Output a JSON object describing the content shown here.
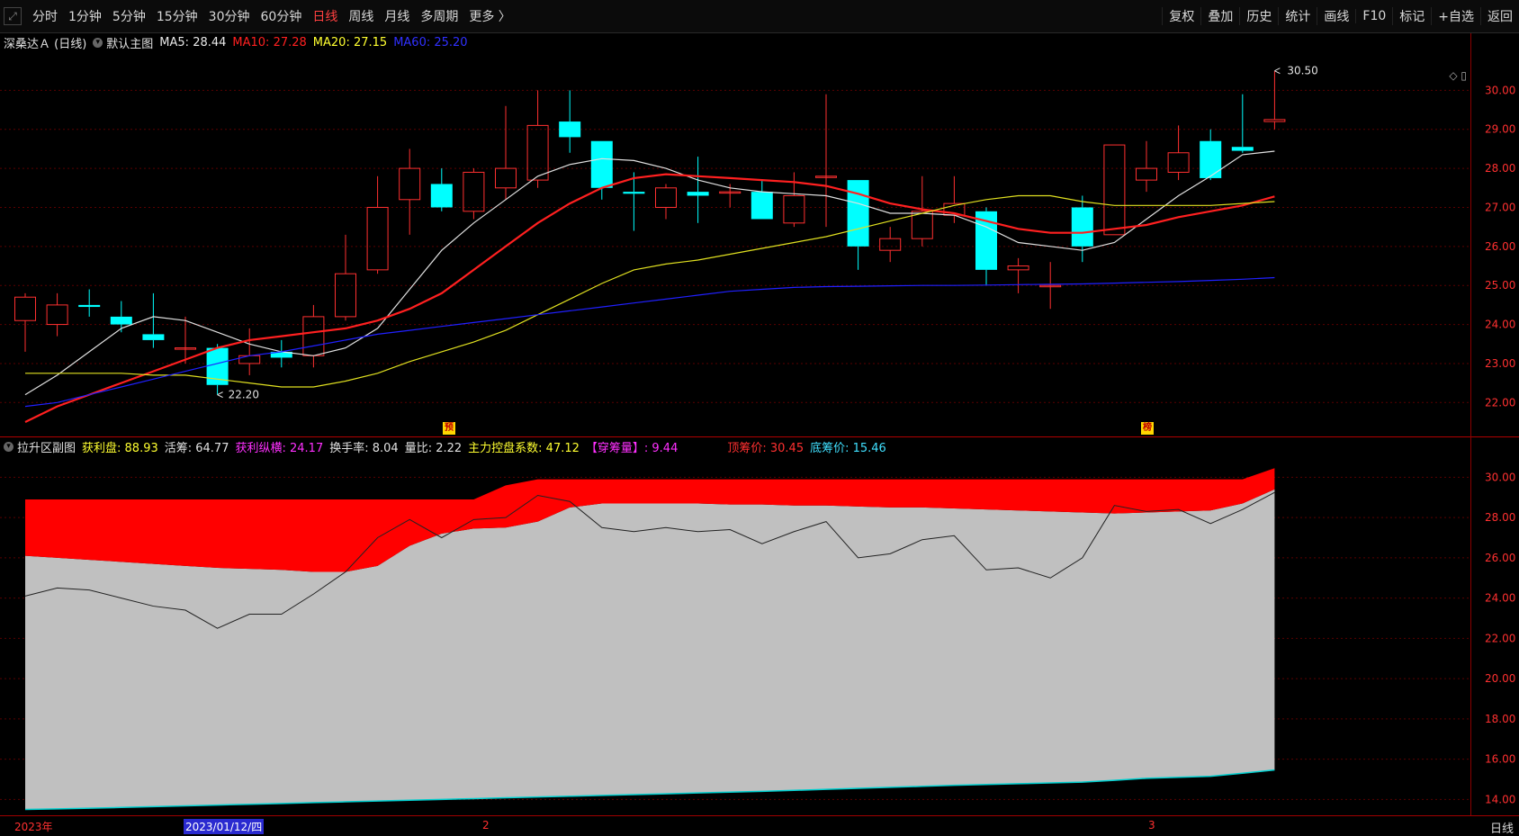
{
  "toolbar": {
    "periods": [
      "分时",
      "1分钟",
      "5分钟",
      "15分钟",
      "30分钟",
      "60分钟",
      "日线",
      "周线",
      "月线",
      "多周期",
      "更多 〉"
    ],
    "active_period": "日线",
    "right_buttons": [
      "复权",
      "叠加",
      "历史",
      "统计",
      "画线",
      "F10",
      "标记",
      "+自选",
      "返回"
    ]
  },
  "main_info": {
    "stock": "深桑达Ａ (日线)",
    "template": "默认主图",
    "ma5": "MA5: 28.44",
    "ma10": "MA10: 27.28",
    "ma20": "MA20: 27.15",
    "ma60": "MA60: 25.20"
  },
  "sub_info": {
    "name": "拉升区副图",
    "profit": "获利盘: 88.93",
    "active": "活筹: 64.77",
    "profit_span": "获利纵横: 24.17",
    "turnover": "换手率: 8.04",
    "volume_ratio": "量比: 2.22",
    "control": "主力控盘系数: 47.12",
    "chip_wear": "【穿筹量】: 9.44",
    "top_price": "顶筹价: 30.45",
    "bottom_price": "底筹价: 15.46"
  },
  "colors": {
    "up": "#ff3030",
    "down": "#00ffff",
    "ma5": "#e0e0e0",
    "ma10": "#ff2020",
    "ma20": "#e0e020",
    "ma60": "#2020ff",
    "grid": "#5a0000",
    "chip_red": "#ff0000",
    "chip_gray": "#c0c0c0",
    "bottom_line": "#00d0d0"
  },
  "markers": {
    "pre": "预",
    "list": "榜"
  },
  "dates": {
    "year": "2023年",
    "cursor": "2023/01/12/四",
    "m2": "2",
    "m3": "3",
    "period": "日线"
  },
  "chart_data": [
    {
      "type": "candlestick",
      "title": "深桑达Ａ (日线)",
      "ylim": [
        21.2,
        31.0
      ],
      "yticks": [
        22,
        23,
        24,
        25,
        26,
        27,
        28,
        29,
        30
      ],
      "annotations": {
        "high": "30.50",
        "low": "22.20"
      },
      "candles": [
        {
          "o": 24.1,
          "h": 24.8,
          "l": 23.3,
          "c": 24.7
        },
        {
          "o": 24.0,
          "h": 24.8,
          "l": 23.7,
          "c": 24.5
        },
        {
          "o": 24.5,
          "h": 24.9,
          "l": 24.2,
          "c": 24.45
        },
        {
          "o": 24.2,
          "h": 24.6,
          "l": 23.8,
          "c": 24.0
        },
        {
          "o": 23.75,
          "h": 24.8,
          "l": 23.4,
          "c": 23.6
        },
        {
          "o": 23.4,
          "h": 24.2,
          "l": 23.0,
          "c": 23.4
        },
        {
          "o": 23.4,
          "h": 23.5,
          "l": 22.2,
          "c": 22.45
        },
        {
          "o": 23.0,
          "h": 23.9,
          "l": 22.7,
          "c": 23.2
        },
        {
          "o": 23.3,
          "h": 23.6,
          "l": 22.9,
          "c": 23.15
        },
        {
          "o": 23.2,
          "h": 24.5,
          "l": 22.9,
          "c": 24.2
        },
        {
          "o": 24.2,
          "h": 26.3,
          "l": 24.1,
          "c": 25.3
        },
        {
          "o": 25.4,
          "h": 27.8,
          "l": 25.3,
          "c": 27.0
        },
        {
          "o": 27.2,
          "h": 28.5,
          "l": 26.3,
          "c": 28.0
        },
        {
          "o": 27.6,
          "h": 28.0,
          "l": 26.9,
          "c": 27.0
        },
        {
          "o": 26.9,
          "h": 28.0,
          "l": 26.7,
          "c": 27.9
        },
        {
          "o": 27.5,
          "h": 29.6,
          "l": 27.2,
          "c": 28.0
        },
        {
          "o": 27.7,
          "h": 30.0,
          "l": 27.5,
          "c": 29.1
        },
        {
          "o": 29.2,
          "h": 30.0,
          "l": 28.4,
          "c": 28.8
        },
        {
          "o": 28.7,
          "h": 28.7,
          "l": 27.2,
          "c": 27.5
        },
        {
          "o": 27.4,
          "h": 27.9,
          "l": 26.4,
          "c": 27.35
        },
        {
          "o": 27.0,
          "h": 27.6,
          "l": 26.7,
          "c": 27.5
        },
        {
          "o": 27.4,
          "h": 28.3,
          "l": 26.6,
          "c": 27.3
        },
        {
          "o": 27.4,
          "h": 27.6,
          "l": 27.0,
          "c": 27.4
        },
        {
          "o": 27.4,
          "h": 27.7,
          "l": 26.7,
          "c": 26.7
        },
        {
          "o": 26.6,
          "h": 27.9,
          "l": 26.5,
          "c": 27.3
        },
        {
          "o": 27.8,
          "h": 29.9,
          "l": 26.5,
          "c": 27.8
        },
        {
          "o": 27.7,
          "h": 27.7,
          "l": 25.4,
          "c": 26.0
        },
        {
          "o": 25.9,
          "h": 26.5,
          "l": 25.6,
          "c": 26.2
        },
        {
          "o": 26.2,
          "h": 27.8,
          "l": 26.0,
          "c": 26.9
        },
        {
          "o": 26.8,
          "h": 27.8,
          "l": 26.6,
          "c": 27.1
        },
        {
          "o": 26.9,
          "h": 27.0,
          "l": 25.0,
          "c": 25.4
        },
        {
          "o": 25.4,
          "h": 25.7,
          "l": 24.8,
          "c": 25.5
        },
        {
          "o": 25.0,
          "h": 25.6,
          "l": 24.4,
          "c": 25.0
        },
        {
          "o": 27.0,
          "h": 27.3,
          "l": 25.6,
          "c": 26.0
        },
        {
          "o": 26.3,
          "h": 28.6,
          "l": 26.3,
          "c": 28.6
        },
        {
          "o": 27.7,
          "h": 28.7,
          "l": 27.4,
          "c": 28.0
        },
        {
          "o": 27.9,
          "h": 29.1,
          "l": 27.7,
          "c": 28.4
        },
        {
          "o": 28.7,
          "h": 29.0,
          "l": 27.7,
          "c": 27.75
        },
        {
          "o": 28.55,
          "h": 29.9,
          "l": 28.4,
          "c": 28.45
        },
        {
          "o": 29.2,
          "h": 30.5,
          "l": 29.0,
          "c": 29.25
        }
      ],
      "series": [
        {
          "name": "MA5",
          "values": [
            22.2,
            22.7,
            23.3,
            23.9,
            24.2,
            24.1,
            23.8,
            23.5,
            23.3,
            23.2,
            23.4,
            23.9,
            24.9,
            25.9,
            26.6,
            27.2,
            27.8,
            28.1,
            28.25,
            28.2,
            28.0,
            27.7,
            27.5,
            27.4,
            27.35,
            27.3,
            27.1,
            26.85,
            26.85,
            26.8,
            26.5,
            26.1,
            26.0,
            25.9,
            26.1,
            26.7,
            27.3,
            27.8,
            28.35,
            28.44
          ]
        },
        {
          "name": "MA10",
          "values": [
            21.5,
            21.9,
            22.2,
            22.5,
            22.8,
            23.1,
            23.4,
            23.6,
            23.7,
            23.8,
            23.9,
            24.1,
            24.4,
            24.8,
            25.4,
            26.0,
            26.6,
            27.1,
            27.5,
            27.75,
            27.85,
            27.8,
            27.75,
            27.7,
            27.65,
            27.55,
            27.35,
            27.1,
            26.95,
            26.85,
            26.65,
            26.45,
            26.35,
            26.35,
            26.45,
            26.55,
            26.75,
            26.9,
            27.05,
            27.28
          ]
        },
        {
          "name": "MA20",
          "values": [
            22.75,
            22.75,
            22.75,
            22.75,
            22.7,
            22.7,
            22.6,
            22.5,
            22.4,
            22.4,
            22.55,
            22.75,
            23.05,
            23.3,
            23.55,
            23.85,
            24.25,
            24.65,
            25.05,
            25.4,
            25.55,
            25.65,
            25.8,
            25.95,
            26.1,
            26.25,
            26.45,
            26.65,
            26.85,
            27.05,
            27.2,
            27.3,
            27.3,
            27.15,
            27.05,
            27.05,
            27.05,
            27.05,
            27.1,
            27.15
          ]
        },
        {
          "name": "MA60",
          "values": [
            21.9,
            22.0,
            22.2,
            22.4,
            22.6,
            22.8,
            23.0,
            23.2,
            23.3,
            23.45,
            23.6,
            23.75,
            23.85,
            23.95,
            24.05,
            24.15,
            24.25,
            24.35,
            24.45,
            24.55,
            24.65,
            24.75,
            24.85,
            24.9,
            24.95,
            24.97,
            24.98,
            24.99,
            25.0,
            25.0,
            25.01,
            25.02,
            25.03,
            25.04,
            25.06,
            25.08,
            25.1,
            25.13,
            25.16,
            25.2
          ]
        }
      ]
    },
    {
      "type": "area",
      "title": "拉升区副图",
      "ylim": [
        13.3,
        31.0
      ],
      "yticks": [
        14,
        16,
        18,
        20,
        22,
        24,
        26,
        28,
        30
      ],
      "series": [
        {
          "name": "顶筹价",
          "values": [
            28.9,
            28.9,
            28.9,
            28.9,
            28.9,
            28.9,
            28.9,
            28.9,
            28.9,
            28.9,
            28.9,
            28.9,
            28.9,
            28.9,
            28.9,
            29.6,
            29.9,
            29.9,
            29.9,
            29.9,
            29.9,
            29.9,
            29.9,
            29.9,
            29.9,
            29.9,
            29.9,
            29.9,
            29.9,
            29.9,
            29.9,
            29.9,
            29.9,
            29.9,
            29.9,
            29.9,
            29.9,
            29.9,
            29.9,
            30.45
          ]
        },
        {
          "name": "获利分界",
          "values": [
            26.1,
            26.0,
            25.9,
            25.8,
            25.7,
            25.6,
            25.5,
            25.45,
            25.4,
            25.3,
            25.3,
            25.6,
            26.6,
            27.2,
            27.45,
            27.5,
            27.8,
            28.5,
            28.7,
            28.7,
            28.7,
            28.7,
            28.65,
            28.65,
            28.6,
            28.6,
            28.55,
            28.5,
            28.5,
            28.45,
            28.4,
            28.35,
            28.3,
            28.25,
            28.2,
            28.25,
            28.3,
            28.35,
            28.7,
            29.4
          ]
        },
        {
          "name": "收盘",
          "values": [
            24.1,
            24.5,
            24.4,
            24.0,
            23.6,
            23.4,
            22.5,
            23.2,
            23.2,
            24.2,
            25.3,
            27.0,
            27.9,
            27.0,
            27.9,
            28.0,
            29.1,
            28.8,
            27.5,
            27.3,
            27.5,
            27.3,
            27.4,
            26.7,
            27.3,
            27.8,
            26.0,
            26.2,
            26.9,
            27.1,
            25.4,
            25.5,
            25.0,
            26.0,
            28.6,
            28.3,
            28.4,
            27.7,
            28.4,
            29.25
          ]
        },
        {
          "name": "底筹价",
          "values": [
            13.5,
            13.53,
            13.56,
            13.6,
            13.64,
            13.68,
            13.72,
            13.76,
            13.8,
            13.84,
            13.88,
            13.92,
            13.96,
            14.0,
            14.04,
            14.08,
            14.12,
            14.16,
            14.2,
            14.24,
            14.28,
            14.32,
            14.36,
            14.4,
            14.45,
            14.5,
            14.55,
            14.6,
            14.65,
            14.7,
            14.74,
            14.78,
            14.82,
            14.86,
            14.95,
            15.05,
            15.1,
            15.15,
            15.3,
            15.46
          ]
        }
      ]
    }
  ]
}
